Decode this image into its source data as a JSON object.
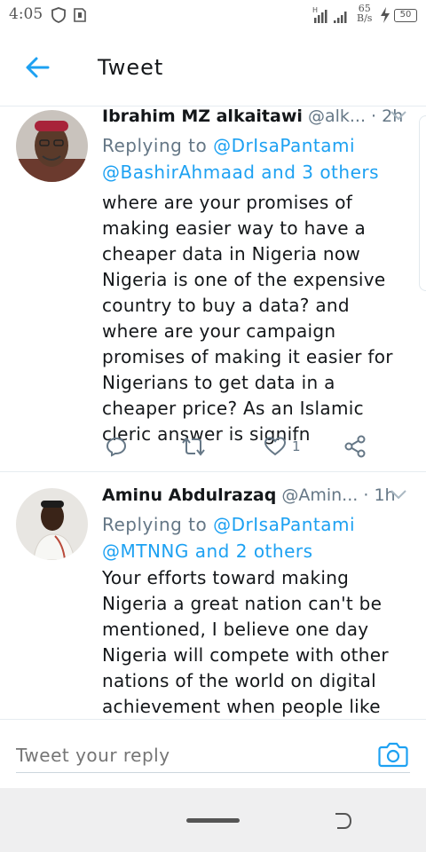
{
  "status_bar": {
    "time": "4:05",
    "network_speed_value": "65",
    "network_speed_unit": "B/s",
    "battery_level": "50",
    "icons": [
      "shield-icon",
      "sim-icon",
      "signal-icon",
      "charging-icon",
      "battery-icon"
    ]
  },
  "header": {
    "title": "Tweet",
    "back_icon": "arrow-left-icon"
  },
  "tweets": [
    {
      "name": "Ibrahim MZ alkaitawi",
      "handle": "@alk...",
      "separator": "·",
      "time": "2h",
      "replying_prefix": "Replying to",
      "replying_to": "@DrIsaPantami",
      "replying_line2": "@BashirAhmaad and 3 others",
      "text": "where are your promises of making easier way to have a cheaper data in Nigeria now Nigeria is one of the expensive country to buy a data? and where are your campaign promises of making it easier for Nigerians to get data in a cheaper price? As an Islamic cleric answer is signifn",
      "like_count": "1"
    },
    {
      "name": "Aminu Abdulrazaq",
      "handle": "@Amin...",
      "separator": "·",
      "time": "1h",
      "replying_prefix": "Replying to",
      "replying_to": "@DrIsaPantami",
      "replying_line2": "@MTNNG and 2 others",
      "text": "Your efforts toward making Nigeria a great nation can't be mentioned, I believe one day Nigeria will compete with other nations of the world on digital achievement when people like you are to be appointed"
    }
  ],
  "composer": {
    "placeholder": "Tweet your reply",
    "camera_icon": "camera-icon"
  },
  "colors": {
    "accent": "#1da1f2",
    "secondary_text": "#657786",
    "primary_text": "#14171a"
  }
}
